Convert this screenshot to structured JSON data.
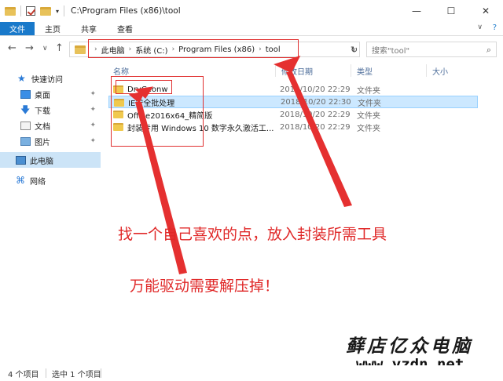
{
  "window": {
    "title": "C:\\Program Files (x86)\\tool",
    "minimize": "—",
    "maximize": "☐",
    "close": "✕"
  },
  "ribbon": {
    "tabs": [
      "文件",
      "主页",
      "共享",
      "查看"
    ],
    "help": "?",
    "collapse": "∨"
  },
  "address": {
    "crumbs": [
      "此电脑",
      "系统 (C:)",
      "Program Files (x86)",
      "tool"
    ],
    "search_placeholder": "搜索\"tool\""
  },
  "sidebar": {
    "items": [
      {
        "label": "快速访问",
        "icon": "star-icon"
      },
      {
        "label": "桌面",
        "icon": "desktop-icon",
        "pinned": true
      },
      {
        "label": "下载",
        "icon": "download-icon",
        "pinned": true
      },
      {
        "label": "文档",
        "icon": "document-icon",
        "pinned": true
      },
      {
        "label": "图片",
        "icon": "pictures-icon",
        "pinned": true
      },
      {
        "label": "此电脑",
        "icon": "computer-icon",
        "selected": true
      },
      {
        "label": "网络",
        "icon": "network-icon"
      }
    ]
  },
  "columns": [
    "名称",
    "修改日期",
    "类型",
    "大小"
  ],
  "files": [
    {
      "name": "DrvCeonw",
      "date": "2018/10/20 22:29",
      "type": "文件夹"
    },
    {
      "name": "IE安全批处理",
      "date": "2018/10/20 22:30",
      "type": "文件夹",
      "selected": true
    },
    {
      "name": "Office2016x64_精简版",
      "date": "2018/10/20 22:29",
      "type": "文件夹"
    },
    {
      "name": "封装专用 Windows 10 数字永久激活工...",
      "date": "2018/10/20 22:29",
      "type": "文件夹"
    }
  ],
  "annotations": {
    "note1": "找一个自己喜欢的点，放入封装所需工具",
    "note2": "万能驱动需要解压掉！"
  },
  "watermark": {
    "text_cn": "藓店亿众电脑",
    "url": "www.yzdn.net"
  },
  "status": {
    "count": "4 个项目",
    "selected": "选中 1 个项目"
  },
  "colors": {
    "accent": "#1979ca",
    "annotation": "#e02828",
    "selection": "#cce8ff"
  }
}
